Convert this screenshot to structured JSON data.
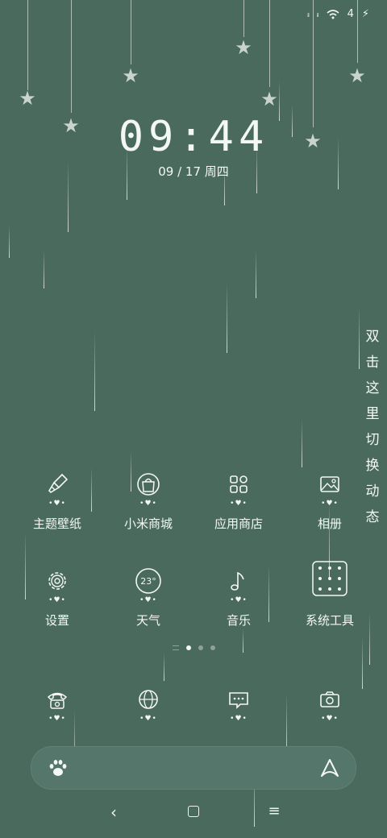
{
  "status_bar": {
    "signal1": "ᵢₗ",
    "signal2": "ᵢₗ",
    "battery_level": "4",
    "charging_icon": "bolt-icon"
  },
  "lockclock": {
    "time": "09:44",
    "date": "09 / 17  周四"
  },
  "side_hint": [
    "双",
    "击",
    "这",
    "里",
    "切",
    "换",
    "动",
    "态"
  ],
  "grid": [
    {
      "label": "主题壁纸",
      "icon": "brush-icon"
    },
    {
      "label": "小米商城",
      "icon": "shop-icon"
    },
    {
      "label": "应用商店",
      "icon": "apps-icon"
    },
    {
      "label": "相册",
      "icon": "gallery-icon"
    },
    {
      "label": "设置",
      "icon": "gear-icon"
    },
    {
      "label": "天气",
      "icon": "weather-icon",
      "temp": "23°"
    },
    {
      "label": "音乐",
      "icon": "music-note-icon"
    },
    {
      "label": "系统工具",
      "icon": "folder-icon"
    }
  ],
  "dock": [
    {
      "icon": "phone-icon"
    },
    {
      "icon": "browser-globe-icon"
    },
    {
      "icon": "message-icon"
    },
    {
      "icon": "camera-icon"
    }
  ],
  "page_indicator": {
    "pages": 3,
    "active": 1
  },
  "deco_hearts": "•♥•",
  "colors": {
    "background": "#4a6a5d",
    "foreground": "#f3f7f5",
    "star": "#c9d3cf"
  }
}
